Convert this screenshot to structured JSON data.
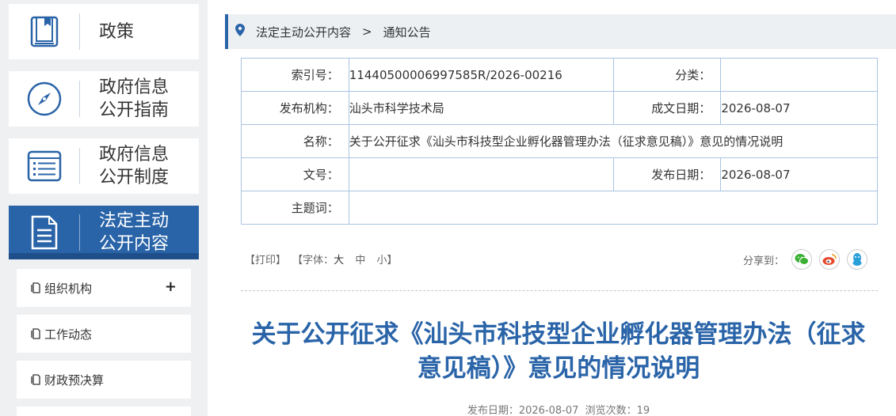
{
  "sidebar": {
    "main_items": [
      {
        "label_line1": "政策",
        "label_line2": "",
        "icon": "book-icon"
      },
      {
        "label_line1": "政府信息",
        "label_line2": "公开指南",
        "icon": "compass-icon"
      },
      {
        "label_line1": "政府信息",
        "label_line2": "公开制度",
        "icon": "list-icon"
      },
      {
        "label_line1": "法定主动",
        "label_line2": "公开内容",
        "icon": "document-icon",
        "active": true
      }
    ],
    "sub_items": [
      {
        "label": "组织机构",
        "expand": "+"
      },
      {
        "label": "工作动态"
      },
      {
        "label": "财政预决算"
      }
    ]
  },
  "breadcrumb": {
    "level1": "法定主动公开内容",
    "separator": ">",
    "level2": "通知公告"
  },
  "info": {
    "index_label": "索引号：",
    "index_value": "11440500006997585R/2026-00216",
    "category_label": "分类：",
    "category_value": "",
    "publisher_label": "发布机构：",
    "publisher_value": "汕头市科学技术局",
    "created_label": "成文日期：",
    "created_value": "2026-08-07",
    "name_label": "名称：",
    "name_value": "关于公开征求《汕头市科技型企业孵化器管理办法（征求意见稿）》意见的情况说明",
    "docno_label": "文号：",
    "docno_value": "",
    "published_label": "发布日期：",
    "published_value": "2026-08-07",
    "subject_label": "主题词：",
    "subject_value": ""
  },
  "tools": {
    "print": "【打印】",
    "font_label": "【字体：",
    "font_large": "大",
    "font_medium": "中",
    "font_small": "小",
    "font_close": "】",
    "share_label": "分享到："
  },
  "article": {
    "title_line1": "关于公开征求《汕头市科技型企业孵化器管理办法（征求",
    "title_line2": "意见稿）》意见的情况说明",
    "meta": "发布日期：2026-08-07  浏览次数：19"
  },
  "colors": {
    "accent": "#2a64a8",
    "wechat": "#3cb034",
    "weibo": "#e6492d",
    "qq": "#2a9fd8"
  }
}
